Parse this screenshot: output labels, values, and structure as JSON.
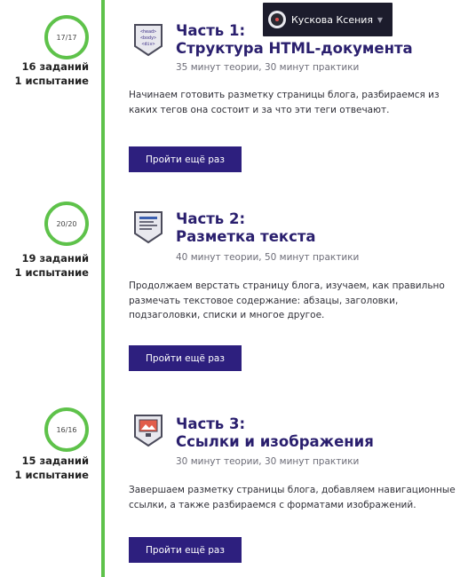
{
  "user_menu": {
    "name": "Кускова Ксения",
    "icon": "chevron-down-icon"
  },
  "chapters": [
    {
      "progress": "17/17",
      "tasks": "16 заданий",
      "trials": "1 испытание",
      "icon": "html-document-icon",
      "title_line1": "Часть 1:",
      "title_line2": "Структура HTML-документа",
      "duration": "35 минут теории, 30 минут практики",
      "description": "Начинаем готовить разметку страницы блога, разбираемся из каких тегов она состоит и за что эти теги отвечают.",
      "button": "Пройти ещё раз",
      "icon_text": [
        "<head>",
        "<body>",
        "<div>"
      ]
    },
    {
      "progress": "20/20",
      "tasks": "19 заданий",
      "trials": "1 испытание",
      "icon": "text-markup-icon",
      "title_line1": "Часть 2:",
      "title_line2": "Разметка текста",
      "duration": "40 минут теории, 50 минут практики",
      "description": "Продолжаем верстать страницу блога, изучаем, как правильно размечать текстовое содержание: абзацы, заголовки, подзаголовки, списки и многое другое.",
      "button": "Пройти ещё раз"
    },
    {
      "progress": "16/16",
      "tasks": "15 заданий",
      "trials": "1 испытание",
      "icon": "image-link-icon",
      "title_line1": "Часть 3:",
      "title_line2": "Ссылки и изображения",
      "duration": "30 минут теории, 30 минут практики",
      "description": "Завершаем разметку страницы блога, добавляем навигационные ссылки, а также разбираемся с форматами изображений.",
      "button": "Пройти ещё раз"
    }
  ],
  "colors": {
    "accent": "#2d1f7e",
    "timeline": "#5ec24a",
    "title": "#2a1f6e"
  }
}
